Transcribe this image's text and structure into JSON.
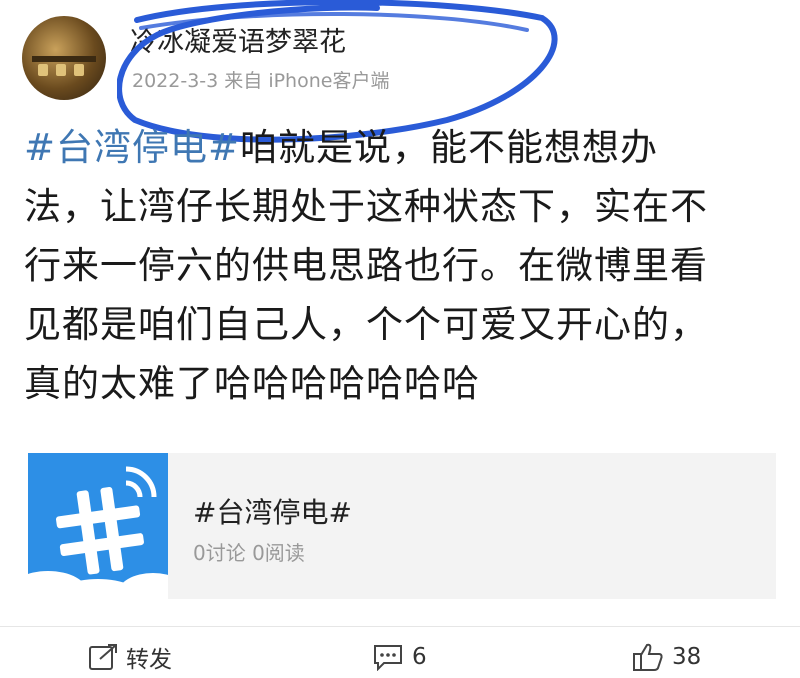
{
  "post": {
    "username": "冷冰凝爱语梦翠花",
    "meta": "2022-3-3 来自 iPhone客户端",
    "hashtag": "#台湾停电#",
    "body_lines": [
      "咱就是说，能不能想想办",
      "法，让湾仔长期处于这种状态下，实在不",
      "行来一停六的供电思路也行。在微博里看",
      "见都是咱们自己人，个个可爱又开心的，",
      "真的太难了哈哈哈哈哈哈哈"
    ]
  },
  "topic_card": {
    "title": "#台湾停电#",
    "stats": "0讨论 0阅读",
    "thumb_icon": "hashtag-wifi-icon"
  },
  "actions": {
    "repost_label": "转发",
    "comment_count": "6",
    "like_count": "38"
  },
  "colors": {
    "hashtag": "#3f77b3",
    "scribble": "#2a5bd7",
    "thumb_bg": "#2d8fe6"
  }
}
